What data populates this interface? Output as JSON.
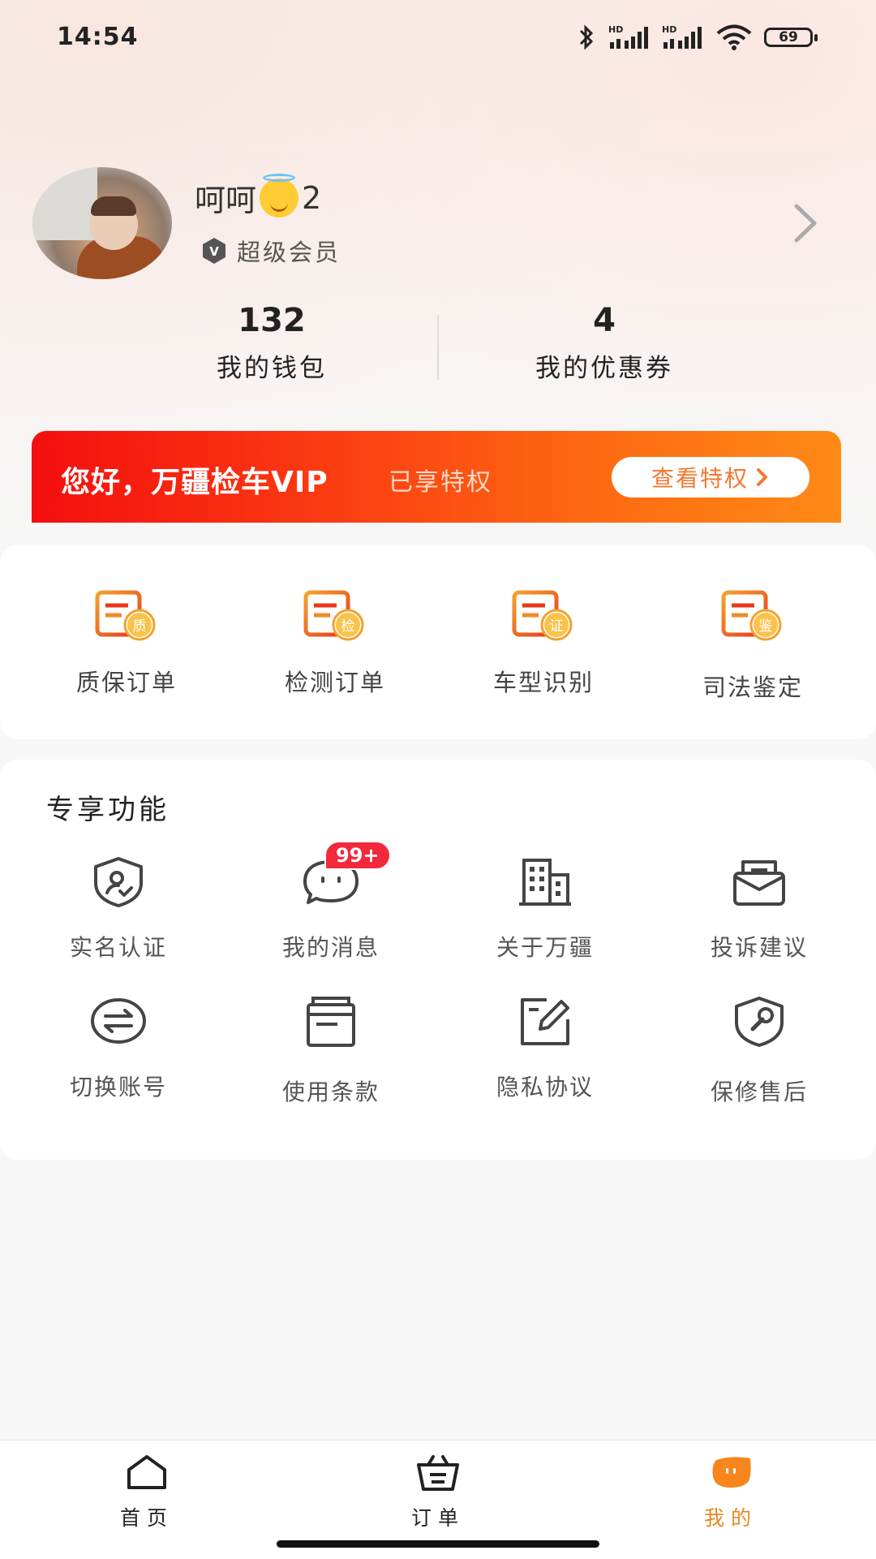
{
  "status_bar": {
    "time": "14:54",
    "battery": "69",
    "icons": [
      "bluetooth-icon",
      "signal-hd-icon",
      "signal-hd-icon",
      "wifi-icon",
      "battery-icon"
    ]
  },
  "profile": {
    "name_prefix": "呵呵",
    "name_emoji": "smiling-face-with-halo",
    "name_suffix": "2",
    "member_level": "超级会员"
  },
  "stats": [
    {
      "value": "132",
      "label": "我的钱包"
    },
    {
      "value": "4",
      "label": "我的优惠券"
    }
  ],
  "vip_banner": {
    "title": "您好，万疆检车VIP",
    "subtitle": "已享特权",
    "button": "查看特权"
  },
  "orders": [
    {
      "label": "质保订单",
      "badge": "质"
    },
    {
      "label": "检测订单",
      "badge": "检"
    },
    {
      "label": "车型识别",
      "badge": "证"
    },
    {
      "label": "司法鉴定",
      "badge": "鉴"
    }
  ],
  "features": {
    "title": "专享功能",
    "message_badge": "99+",
    "items": [
      {
        "label": "实名认证",
        "icon": "shield-user-icon"
      },
      {
        "label": "我的消息",
        "icon": "chat-bubble-icon"
      },
      {
        "label": "关于万疆",
        "icon": "building-icon"
      },
      {
        "label": "投诉建议",
        "icon": "mail-icon"
      },
      {
        "label": "切换账号",
        "icon": "switch-arrows-icon"
      },
      {
        "label": "使用条款",
        "icon": "document-icon"
      },
      {
        "label": "隐私协议",
        "icon": "edit-icon"
      },
      {
        "label": "保修售后",
        "icon": "shield-wrench-icon"
      }
    ]
  },
  "tabbar": [
    {
      "label": "首页",
      "icon": "home-icon",
      "active": false
    },
    {
      "label": "订单",
      "icon": "basket-icon",
      "active": false
    },
    {
      "label": "我的",
      "icon": "profile-face-icon",
      "active": true
    }
  ],
  "colors": {
    "accent": "#f5772f",
    "banner_start": "#f40e0e",
    "banner_end": "#fe8a16",
    "badge_red": "#f2293b",
    "tab_active": "#e58a1f"
  }
}
